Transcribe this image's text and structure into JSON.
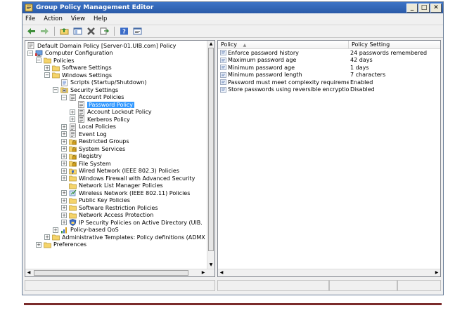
{
  "window": {
    "title": "Group Policy Management Editor",
    "controls": [
      "_",
      "□",
      "✕"
    ]
  },
  "menu": [
    "File",
    "Action",
    "View",
    "Help"
  ],
  "toolbar": [
    "back-icon",
    "forward-icon",
    "up-folder-icon",
    "show-hide-tree-icon",
    "delete-icon",
    "export-icon",
    "help-icon",
    "properties-icon"
  ],
  "tree": [
    {
      "label": "Default Domain Policy [Server-01.UIB.com] Policy",
      "depth": 0,
      "expander": "",
      "icon": "gpo"
    },
    {
      "label": "Computer Configuration",
      "depth": 0,
      "expander": "-",
      "icon": "computer"
    },
    {
      "label": "Policies",
      "depth": 1,
      "expander": "-",
      "icon": "folder"
    },
    {
      "label": "Software Settings",
      "depth": 2,
      "expander": "+",
      "icon": "folder"
    },
    {
      "label": "Windows Settings",
      "depth": 2,
      "expander": "-",
      "icon": "folder"
    },
    {
      "label": "Scripts (Startup/Shutdown)",
      "depth": 3,
      "expander": "",
      "icon": "script"
    },
    {
      "label": "Security Settings",
      "depth": 3,
      "expander": "-",
      "icon": "security"
    },
    {
      "label": "Account Policies",
      "depth": 4,
      "expander": "-",
      "icon": "policy"
    },
    {
      "label": "Password Policy",
      "depth": 5,
      "expander": "",
      "icon": "policy",
      "selected": true
    },
    {
      "label": "Account Lockout Policy",
      "depth": 5,
      "expander": "+",
      "icon": "policy"
    },
    {
      "label": "Kerberos Policy",
      "depth": 5,
      "expander": "+",
      "icon": "policy"
    },
    {
      "label": "Local Policies",
      "depth": 4,
      "expander": "+",
      "icon": "policy"
    },
    {
      "label": "Event Log",
      "depth": 4,
      "expander": "+",
      "icon": "policy"
    },
    {
      "label": "Restricted Groups",
      "depth": 4,
      "expander": "+",
      "icon": "lockfolder"
    },
    {
      "label": "System Services",
      "depth": 4,
      "expander": "+",
      "icon": "lockfolder"
    },
    {
      "label": "Registry",
      "depth": 4,
      "expander": "+",
      "icon": "lockfolder"
    },
    {
      "label": "File System",
      "depth": 4,
      "expander": "+",
      "icon": "lockfolder"
    },
    {
      "label": "Wired Network (IEEE 802.3) Policies",
      "depth": 4,
      "expander": "+",
      "icon": "network"
    },
    {
      "label": "Windows Firewall with Advanced Security",
      "depth": 4,
      "expander": "+",
      "icon": "folder"
    },
    {
      "label": "Network List Manager Policies",
      "depth": 4,
      "expander": "",
      "icon": "folder"
    },
    {
      "label": "Wireless Network (IEEE 802.11) Policies",
      "depth": 4,
      "expander": "+",
      "icon": "wireless"
    },
    {
      "label": "Public Key Policies",
      "depth": 4,
      "expander": "+",
      "icon": "folder"
    },
    {
      "label": "Software Restriction Policies",
      "depth": 4,
      "expander": "+",
      "icon": "folder"
    },
    {
      "label": "Network Access Protection",
      "depth": 4,
      "expander": "+",
      "icon": "folder"
    },
    {
      "label": "IP Security Policies on Active Directory (UIB.",
      "depth": 4,
      "expander": "+",
      "icon": "ipsec"
    },
    {
      "label": "Policy-based QoS",
      "depth": 3,
      "expander": "+",
      "icon": "qos"
    },
    {
      "label": "Administrative Templates: Policy definitions (ADMX fi",
      "depth": 2,
      "expander": "+",
      "icon": "folder"
    },
    {
      "label": "Preferences",
      "depth": 1,
      "expander": "+",
      "icon": "folder"
    }
  ],
  "list": {
    "columns": [
      "Policy",
      "Policy Setting"
    ],
    "rows": [
      {
        "policy": "Enforce password history",
        "setting": "24 passwords remembered"
      },
      {
        "policy": "Maximum password age",
        "setting": "42 days"
      },
      {
        "policy": "Minimum password age",
        "setting": "1 days"
      },
      {
        "policy": "Minimum password length",
        "setting": "7 characters"
      },
      {
        "policy": "Password must meet complexity requirements",
        "setting": "Enabled"
      },
      {
        "policy": "Store passwords using reversible encryption",
        "setting": "Disabled"
      }
    ]
  },
  "colors": {
    "titlebar": "#2f63b5",
    "selection": "#3399ff",
    "folder": "#f5d46b",
    "footer_line": "#7b2b2b"
  }
}
